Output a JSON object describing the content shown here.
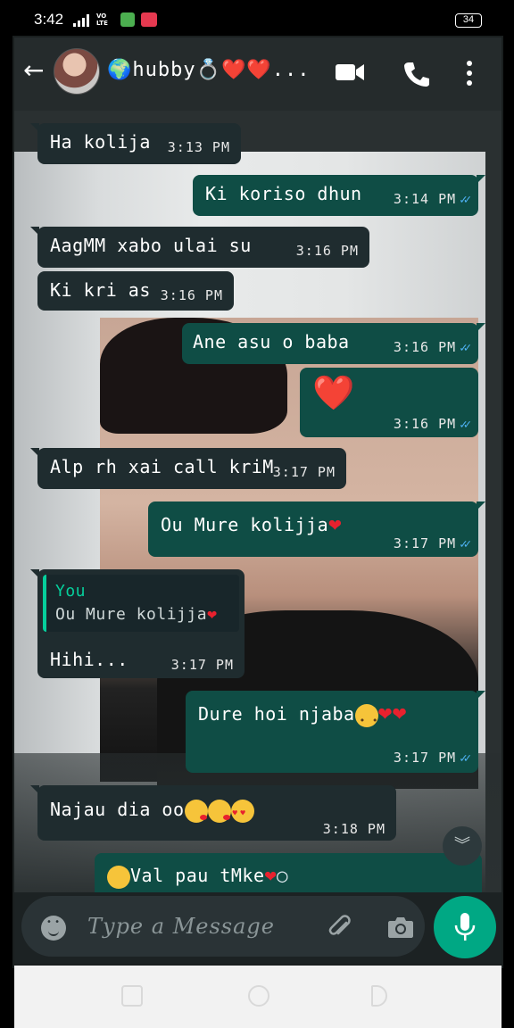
{
  "status_bar": {
    "time": "3:42",
    "network": "VO\nLTE",
    "battery": "34"
  },
  "header": {
    "contact_name": "🌍hubby💍❤️❤️...",
    "icons": [
      "back-arrow-icon",
      "avatar",
      "video-call-icon",
      "voice-call-icon",
      "more-menu-icon"
    ]
  },
  "messages": [
    {
      "dir": "in",
      "text": "Ha kolija",
      "time": "3:13 PM"
    },
    {
      "dir": "out",
      "text": "Ki koriso dhun",
      "time": "3:14 PM",
      "ticks": "✓✓"
    },
    {
      "dir": "in",
      "text": "AagMM xabo ulai su",
      "time": "3:16 PM"
    },
    {
      "dir": "in",
      "text": "Ki kri as",
      "time": "3:16 PM"
    },
    {
      "dir": "out",
      "text": "Ane asu o baba",
      "time": "3:16 PM",
      "ticks": "✓✓"
    },
    {
      "dir": "out",
      "text": "❤️",
      "time": "3:16 PM",
      "ticks": "✓✓"
    },
    {
      "dir": "in",
      "text": "Alp rh xai call kriM",
      "time": "3:17 PM"
    },
    {
      "dir": "out",
      "text": "Ou Mure kolijja",
      "time": "3:17 PM",
      "ticks": "✓✓"
    },
    {
      "dir": "in",
      "reply_to": "You",
      "quoted": "Ou Mure kolijja",
      "text": "Hihi...",
      "time": "3:17 PM"
    },
    {
      "dir": "out",
      "text": "Dure hoi njaba",
      "time": "3:17 PM",
      "ticks": "✓✓"
    },
    {
      "dir": "in",
      "text": "Najau dia oo",
      "time": "3:18 PM"
    },
    {
      "dir": "out",
      "text": "Val pau tMke"
    }
  ],
  "composer": {
    "placeholder": "Type a Message"
  },
  "colors": {
    "incoming_bubble": "#1f2c2f",
    "outgoing_bubble": "#0f4d45",
    "accent": "#00a884",
    "read_ticks": "#4fb3f6"
  }
}
